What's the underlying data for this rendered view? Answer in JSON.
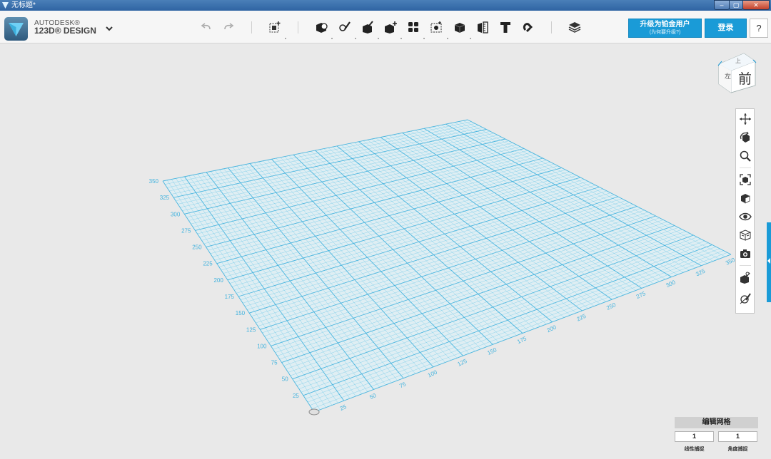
{
  "window": {
    "title": "无标题*",
    "buttons": {
      "minimize": "–",
      "maximize": "▢",
      "close": "✕"
    }
  },
  "app": {
    "brand_line1": "AUTODESK®",
    "brand_line2": "123D® DESIGN"
  },
  "toolbar": {
    "tools": [
      "undo-icon",
      "redo-icon",
      "transform-icon",
      "primitives-icon",
      "sketch-icon",
      "construct-icon",
      "modify-icon",
      "pattern-icon",
      "group-icon",
      "combine-icon",
      "measure-icon",
      "text-icon",
      "snap-icon",
      "material-icon"
    ]
  },
  "account": {
    "upgrade_label": "升级为铂金用户",
    "upgrade_sub": "(为何要升级?)",
    "login_label": "登录",
    "help_label": "?"
  },
  "viewcube": {
    "front_label": "前",
    "left_label": "左",
    "top_label": "上"
  },
  "nav": [
    "pan-icon",
    "orbit-icon",
    "zoom-icon",
    "fit-icon",
    "views-icon",
    "visibility-icon",
    "materials-outline-icon",
    "screenshot-icon",
    "snap-grid-icon",
    "hide-sketch-icon"
  ],
  "grid": {
    "left_axis_labels": [
      "25",
      "50",
      "75",
      "100",
      "125",
      "150",
      "175",
      "200",
      "225",
      "250",
      "275",
      "300",
      "325",
      "350"
    ],
    "bottom_axis_labels": [
      "25",
      "50",
      "75",
      "100",
      "125",
      "150",
      "175",
      "200",
      "225",
      "250",
      "275",
      "300",
      "325",
      "350"
    ],
    "line_color": "#5bc3e6",
    "major_color": "#43b3de"
  },
  "grid_panel": {
    "title": "编辑网格",
    "linear_value": "1",
    "angle_value": "1",
    "linear_label": "线性捕捉",
    "angle_label": "角度捕捉"
  },
  "colors": {
    "accent": "#1a9bd7",
    "background": "#e9e9e9"
  }
}
